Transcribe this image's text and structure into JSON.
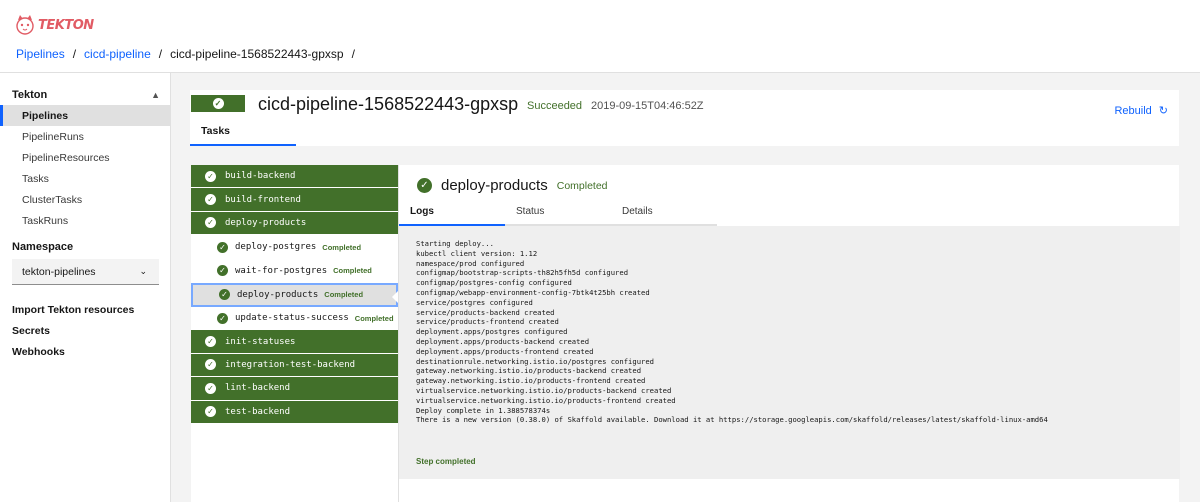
{
  "app": {
    "logo_text": "TEKTON"
  },
  "breadcrumb": {
    "items": [
      "Pipelines",
      "cicd-pipeline",
      "cicd-pipeline-1568522443-gpxsp"
    ],
    "separator": "/"
  },
  "sidebar": {
    "section_title": "Tekton",
    "items": [
      {
        "label": "Pipelines"
      },
      {
        "label": "PipelineRuns"
      },
      {
        "label": "PipelineResources"
      },
      {
        "label": "Tasks"
      },
      {
        "label": "ClusterTasks"
      },
      {
        "label": "TaskRuns"
      }
    ],
    "namespace_label": "Namespace",
    "namespace_value": "tekton-pipelines",
    "links": [
      "Import Tekton resources",
      "Secrets",
      "Webhooks"
    ]
  },
  "run": {
    "name": "cicd-pipeline-1568522443-gpxsp",
    "status": "Succeeded",
    "timestamp": "2019-09-15T04:46:52Z",
    "rebuild_label": "Rebuild",
    "tab_label": "Tasks"
  },
  "tasks": [
    {
      "name": "build-backend"
    },
    {
      "name": "build-frontend"
    },
    {
      "name": "deploy-products"
    },
    {
      "name": "init-statuses"
    },
    {
      "name": "integration-test-backend"
    },
    {
      "name": "lint-backend"
    },
    {
      "name": "test-backend"
    }
  ],
  "steps": [
    {
      "name": "deploy-postgres",
      "status": "Completed"
    },
    {
      "name": "wait-for-postgres",
      "status": "Completed"
    },
    {
      "name": "deploy-products",
      "status": "Completed"
    },
    {
      "name": "update-status-success",
      "status": "Completed"
    }
  ],
  "step_detail": {
    "title": "deploy-products",
    "status": "Completed",
    "tabs": [
      "Logs",
      "Status",
      "Details"
    ],
    "log_lines": [
      "Starting deploy...",
      "kubectl client version: 1.12",
      "namespace/prod configured",
      "configmap/bootstrap-scripts-th82h5fh5d configured",
      "configmap/postgres-config configured",
      "configmap/webapp-environment-config-7btk4t25bh created",
      "service/postgres configured",
      "service/products-backend created",
      "service/products-frontend created",
      "deployment.apps/postgres configured",
      "deployment.apps/products-backend created",
      "deployment.apps/products-frontend created",
      "destinationrule.networking.istio.io/postgres configured",
      "gateway.networking.istio.io/products-backend created",
      "gateway.networking.istio.io/products-frontend created",
      "virtualservice.networking.istio.io/products-backend created",
      "virtualservice.networking.istio.io/products-frontend created",
      "Deploy complete in 1.388578374s",
      "There is a new version (0.38.0) of Skaffold available. Download it at https://storage.googleapis.com/skaffold/releases/latest/skaffold-linux-amd64"
    ],
    "log_footer": "Step completed"
  },
  "colors": {
    "success": "#42702a",
    "link": "#0f62fe",
    "brand": "#e15b64"
  }
}
